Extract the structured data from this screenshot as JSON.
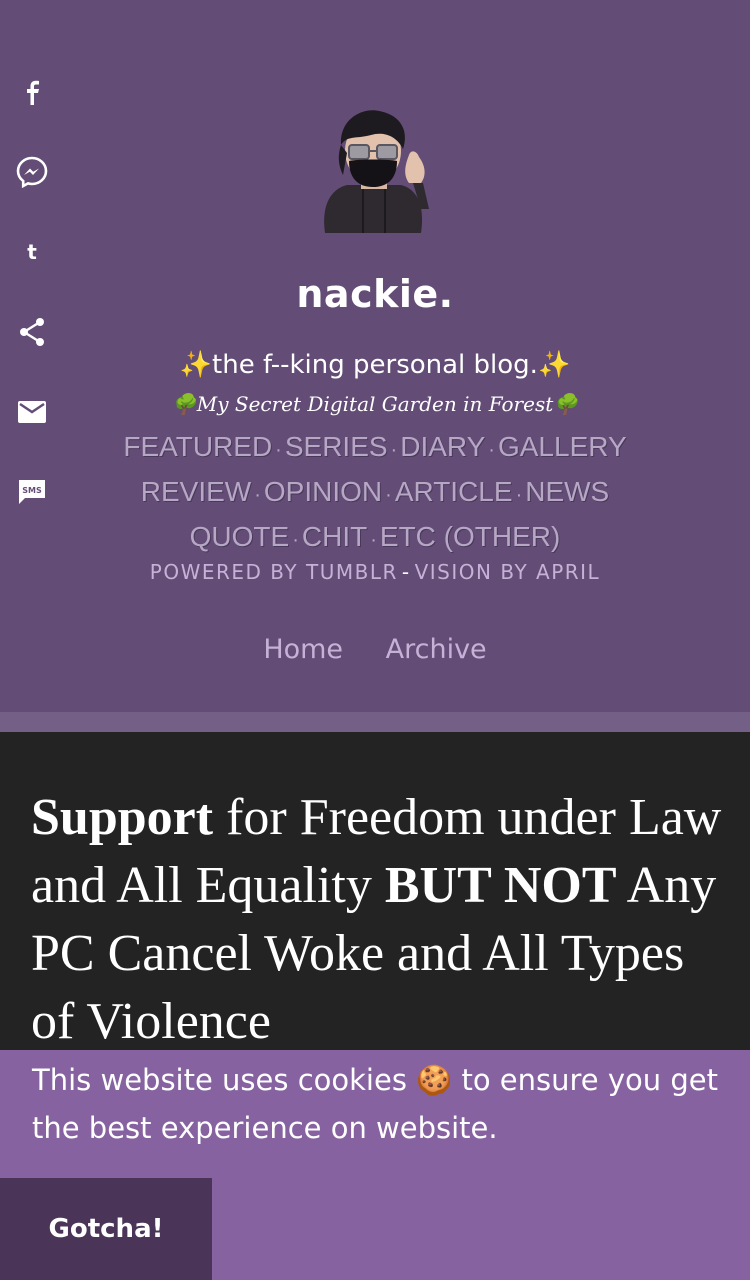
{
  "share": {
    "items": [
      {
        "icon": "facebook-icon",
        "label": "f"
      },
      {
        "icon": "messenger-icon"
      },
      {
        "icon": "tumblr-icon",
        "label": "t"
      },
      {
        "icon": "share-icon"
      },
      {
        "icon": "email-icon"
      },
      {
        "icon": "sms-icon",
        "label": "SMS"
      }
    ]
  },
  "header": {
    "title": "nackie.",
    "tagline": "✨the f--king personal blog.✨",
    "subtagline": "🌳My Secret Digital Garden in Forest🌳",
    "categories_row1": [
      "FEATURED",
      "SERIES",
      "DIARY",
      "GALLERY"
    ],
    "categories_row2": [
      "REVIEW",
      "OPINION",
      "ARTICLE",
      "NEWS"
    ],
    "categories_row3": [
      "QUOTE",
      "CHIT",
      "ETC (OTHER)"
    ],
    "separator": "·",
    "powered_by": "POWERED BY TUMBLR",
    "credits_dash": "-",
    "vision_by": "VISION BY APRIL"
  },
  "nav": {
    "home": "Home",
    "archive": "Archive"
  },
  "post": {
    "title_bold1": "Support",
    "title_part1": " for Freedom under Law and All Equality ",
    "title_bold2": "BUT NOT",
    "title_part2": " Any PC Cancel Woke and All Types of Violence"
  },
  "cookie": {
    "message": "This website uses cookies 🍪 to ensure you get the best experience on website.",
    "button": "Gotcha!"
  },
  "colors": {
    "header_bg": "#634c76",
    "post_bg": "#232323",
    "cookie_bg": "#8663a0",
    "cookie_button_bg": "#4a3458",
    "nav_text": "#c5b2d6"
  }
}
